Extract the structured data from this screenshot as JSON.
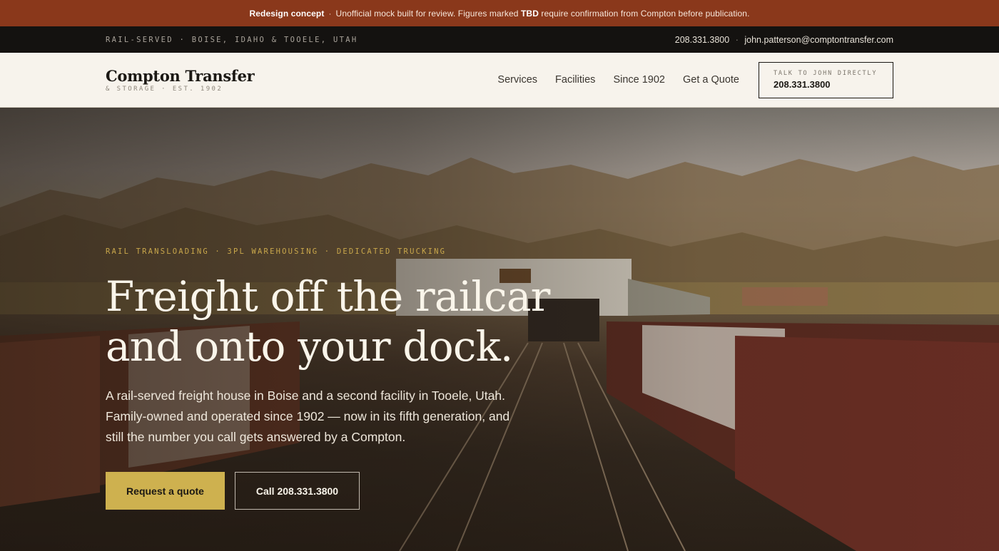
{
  "notice": {
    "label": "Redesign concept",
    "separator": "·",
    "text_before": "Unofficial mock built for review. Figures marked",
    "highlight": "TBD",
    "text_after": "require confirmation from Compton before publication."
  },
  "topbar": {
    "locations": "RAIL-SERVED · BOISE, IDAHO & TOOELE, UTAH",
    "phone": "208.331.3800",
    "separator": "·",
    "email": "john.patterson@comptontransfer.com"
  },
  "header": {
    "brand_name": "Compton Transfer",
    "brand_sub": "& STORAGE · EST. 1902",
    "nav": [
      "Services",
      "Facilities",
      "Since 1902",
      "Get a Quote"
    ],
    "cta_kicker": "TALK TO JOHN DIRECTLY",
    "cta_phone": "208.331.3800"
  },
  "hero": {
    "eyebrow": "RAIL TRANSLOADING · 3PL WAREHOUSING · DEDICATED TRUCKING",
    "headline_line1": "Freight off the railcar",
    "headline_line2": "and onto your dock.",
    "lede": "A rail-served freight house in Boise and a second facility in Tooele, Utah. Family-owned and operated since 1902 — now in its fifth generation, and still the number you call gets answered by a Compton.",
    "primary_button": "Request a quote",
    "secondary_button": "Call 208.331.3800"
  },
  "colors": {
    "notice_bg": "#8a381b",
    "topbar_bg": "#141210",
    "header_bg": "#f7f3ec",
    "accent_gold": "#ceb14f",
    "eyebrow_gold": "#c9a74b"
  }
}
